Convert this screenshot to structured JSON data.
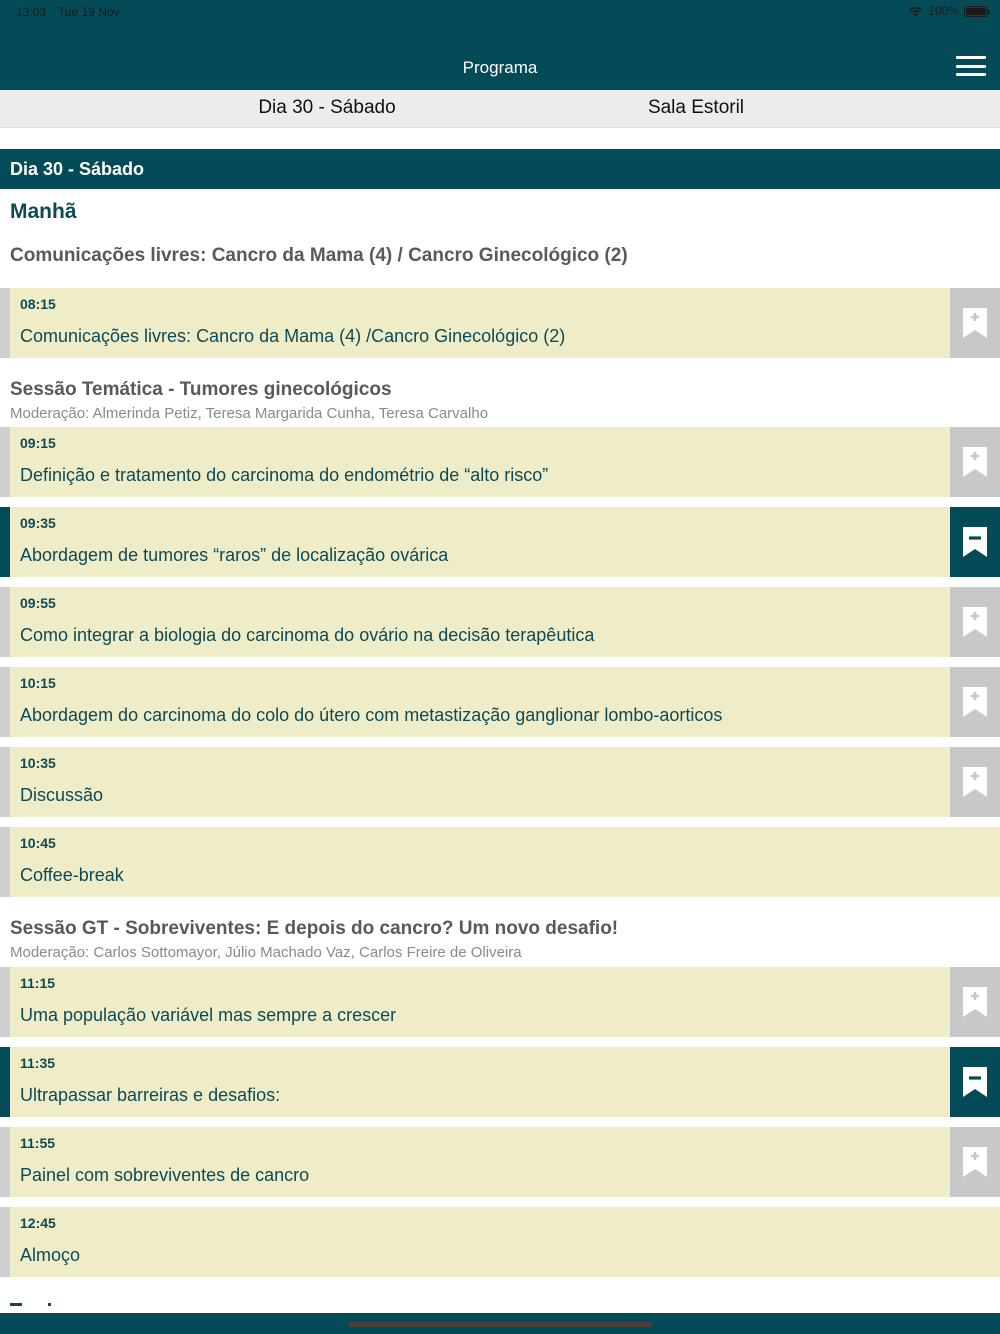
{
  "status_bar": {
    "time": "13:03",
    "date": "Tue 19 Nov",
    "battery": "100%"
  },
  "header": {
    "title": "Programa"
  },
  "filters": {
    "day": "Dia 30 - Sábado",
    "room": "Sala Estoril"
  },
  "day_bar": "Dia 30 - Sábado",
  "period": "Manhã",
  "sessions": [
    {
      "title": "Comunicações livres: Cancro da Mama (4) / Cancro Ginecológico (2)",
      "moderation": "",
      "items": [
        {
          "time": "08:15",
          "title": "Comunicações livres: Cancro da Mama (4) /Cancro Ginecológico (2)",
          "bookmarkable": true,
          "bookmarked": false
        }
      ]
    },
    {
      "title": "Sessão Temática - Tumores ginecológicos",
      "moderation": "Moderação: Almerinda Petiz, Teresa Margarida Cunha, Teresa Carvalho",
      "items": [
        {
          "time": "09:15",
          "title": "Definição e tratamento do carcinoma do endométrio de “alto risco”",
          "bookmarkable": true,
          "bookmarked": false
        },
        {
          "time": "09:35",
          "title": "Abordagem de tumores “raros” de localização ovárica",
          "bookmarkable": true,
          "bookmarked": true
        },
        {
          "time": "09:55",
          "title": "Como integrar a biologia do carcinoma do ovário na decisão terapêutica",
          "bookmarkable": true,
          "bookmarked": false
        },
        {
          "time": "10:15",
          "title": "Abordagem do carcinoma do colo do útero com metastização ganglionar lombo-aorticos",
          "bookmarkable": true,
          "bookmarked": false
        },
        {
          "time": "10:35",
          "title": "Discussão",
          "bookmarkable": true,
          "bookmarked": false
        },
        {
          "time": "10:45",
          "title": "Coffee-break",
          "bookmarkable": false,
          "bookmarked": false
        }
      ]
    },
    {
      "title": "Sessão GT - Sobreviventes: E depois do cancro? Um novo desafio!",
      "moderation": "Moderação: Carlos Sottomayor, Júlio Machado Vaz, Carlos Freire de Oliveira",
      "items": [
        {
          "time": "11:15",
          "title": "Uma população variável mas sempre a crescer",
          "bookmarkable": true,
          "bookmarked": false
        },
        {
          "time": "11:35",
          "title": "Ultrapassar barreiras e desafios:",
          "bookmarkable": true,
          "bookmarked": true
        },
        {
          "time": "11:55",
          "title": "Painel com sobreviventes de cancro",
          "bookmarkable": true,
          "bookmarked": false
        },
        {
          "time": "12:45",
          "title": "Almoço",
          "bookmarkable": false,
          "bookmarked": false
        }
      ]
    }
  ],
  "icons": {
    "menu": "hamburger-menu-icon",
    "bookmark_add": "bookmark-add-icon",
    "bookmark_remove": "bookmark-remove-icon",
    "wifi": "wifi-icon",
    "battery": "battery-icon"
  },
  "colors": {
    "primary": "#044b57",
    "item_bg": "#eeedc8",
    "bookmark_inactive": "#c8c8c8",
    "session_title": "#595959"
  }
}
